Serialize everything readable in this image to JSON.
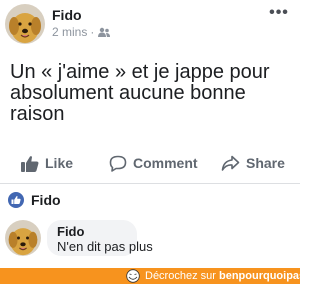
{
  "post": {
    "author": "Fido",
    "time": "2 mins",
    "separator": "·",
    "audience_icon": "friends-icon",
    "more_icon": "more-icon",
    "more_label": "•••",
    "text": "Un « j'aime » et je jappe pour absolument aucune bonne raison"
  },
  "actions": {
    "like_label": "Like",
    "comment_label": "Comment",
    "share_label": "Share",
    "like_icon": "thumbs-up-icon",
    "comment_icon": "comment-icon",
    "share_icon": "share-icon"
  },
  "reactions": {
    "icon": "like-reaction-icon",
    "name": "Fido"
  },
  "comment": {
    "author": "Fido",
    "text": "N'en dit pas plus"
  },
  "watermark": {
    "prefix": "Décrochez sur ",
    "site": "benpourquoipas.com"
  },
  "colors": {
    "accent_blue": "#4267b2",
    "secondary_text": "#606770",
    "watermark_orange": "#f7931e",
    "bubble_gray": "#f2f3f5"
  }
}
